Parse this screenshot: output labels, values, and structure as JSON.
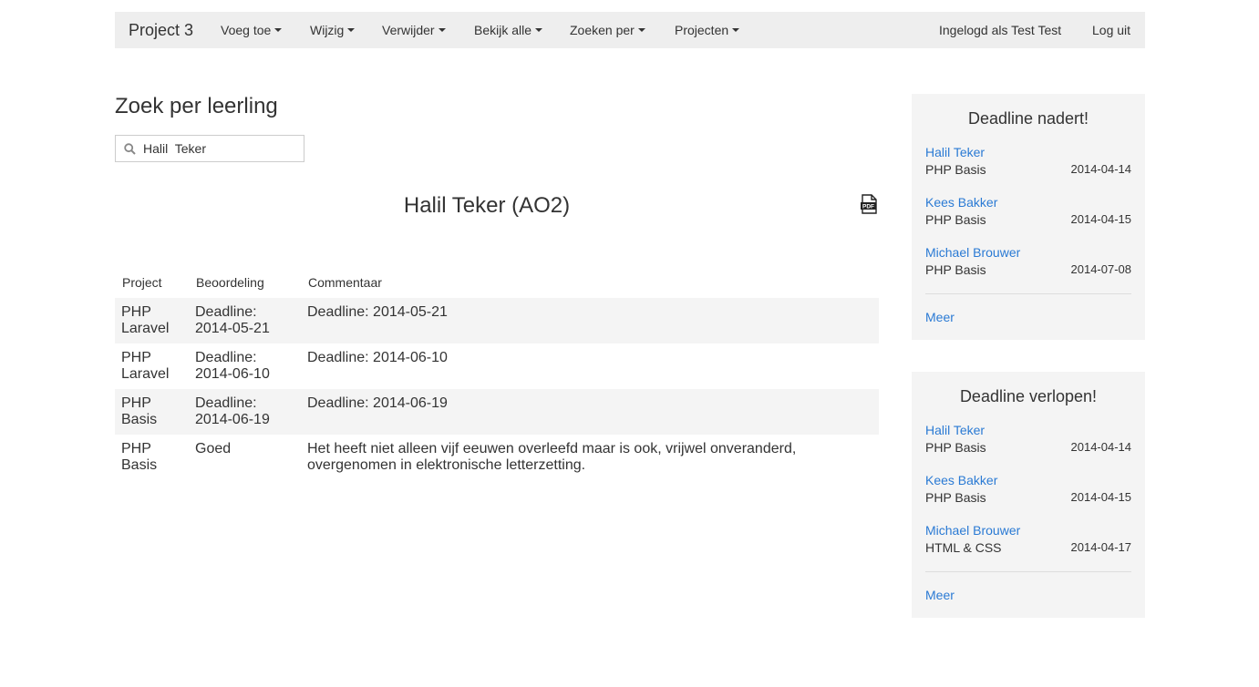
{
  "navbar": {
    "brand": "Project 3",
    "menus": [
      {
        "label": "Voeg toe"
      },
      {
        "label": "Wijzig"
      },
      {
        "label": "Verwijder"
      },
      {
        "label": "Bekijk alle"
      },
      {
        "label": "Zoeken per"
      },
      {
        "label": "Projecten"
      }
    ],
    "user_label": "Ingelogd als Test Test",
    "logout_label": "Log uit"
  },
  "main": {
    "title": "Zoek per leerling",
    "search": {
      "value": "Halil  Teker",
      "icon": "search-icon"
    },
    "student_heading": "Halil Teker (AO2)",
    "pdf_icon": "pdf-icon",
    "table": {
      "headers": [
        "Project",
        "Beoordeling",
        "Commentaar"
      ],
      "rows": [
        {
          "project": "PHP Laravel",
          "beoordeling": "Deadline: 2014-05-21",
          "commentaar": "Deadline: 2014-05-21"
        },
        {
          "project": "PHP Laravel",
          "beoordeling": "Deadline: 2014-06-10",
          "commentaar": "Deadline: 2014-06-10"
        },
        {
          "project": "PHP Basis",
          "beoordeling": "Deadline: 2014-06-19",
          "commentaar": "Deadline: 2014-06-19"
        },
        {
          "project": "PHP Basis",
          "beoordeling": "Goed",
          "commentaar": "Het heeft niet alleen vijf eeuwen overleefd maar is ook, vrijwel onveranderd, overgenomen in elektronische letterzetting."
        }
      ]
    }
  },
  "sidebar": {
    "panels": [
      {
        "title": "Deadline nadert!",
        "entries": [
          {
            "name": "Halil Teker",
            "course": "PHP Basis",
            "date": "2014-04-14"
          },
          {
            "name": "Kees Bakker",
            "course": "PHP Basis",
            "date": "2014-04-15"
          },
          {
            "name": "Michael Brouwer",
            "course": "PHP Basis",
            "date": "2014-07-08"
          }
        ],
        "more": "Meer"
      },
      {
        "title": "Deadline verlopen!",
        "entries": [
          {
            "name": "Halil Teker",
            "course": "PHP Basis",
            "date": "2014-04-14"
          },
          {
            "name": "Kees Bakker",
            "course": "PHP Basis",
            "date": "2014-04-15"
          },
          {
            "name": "Michael Brouwer",
            "course": "HTML & CSS",
            "date": "2014-04-17"
          }
        ],
        "more": "Meer"
      }
    ]
  },
  "colors": {
    "link": "#2a7ad4",
    "navbar_bg": "#eeeeee",
    "panel_bg": "#f4f4f4",
    "stripe_bg": "#f4f4f4"
  }
}
